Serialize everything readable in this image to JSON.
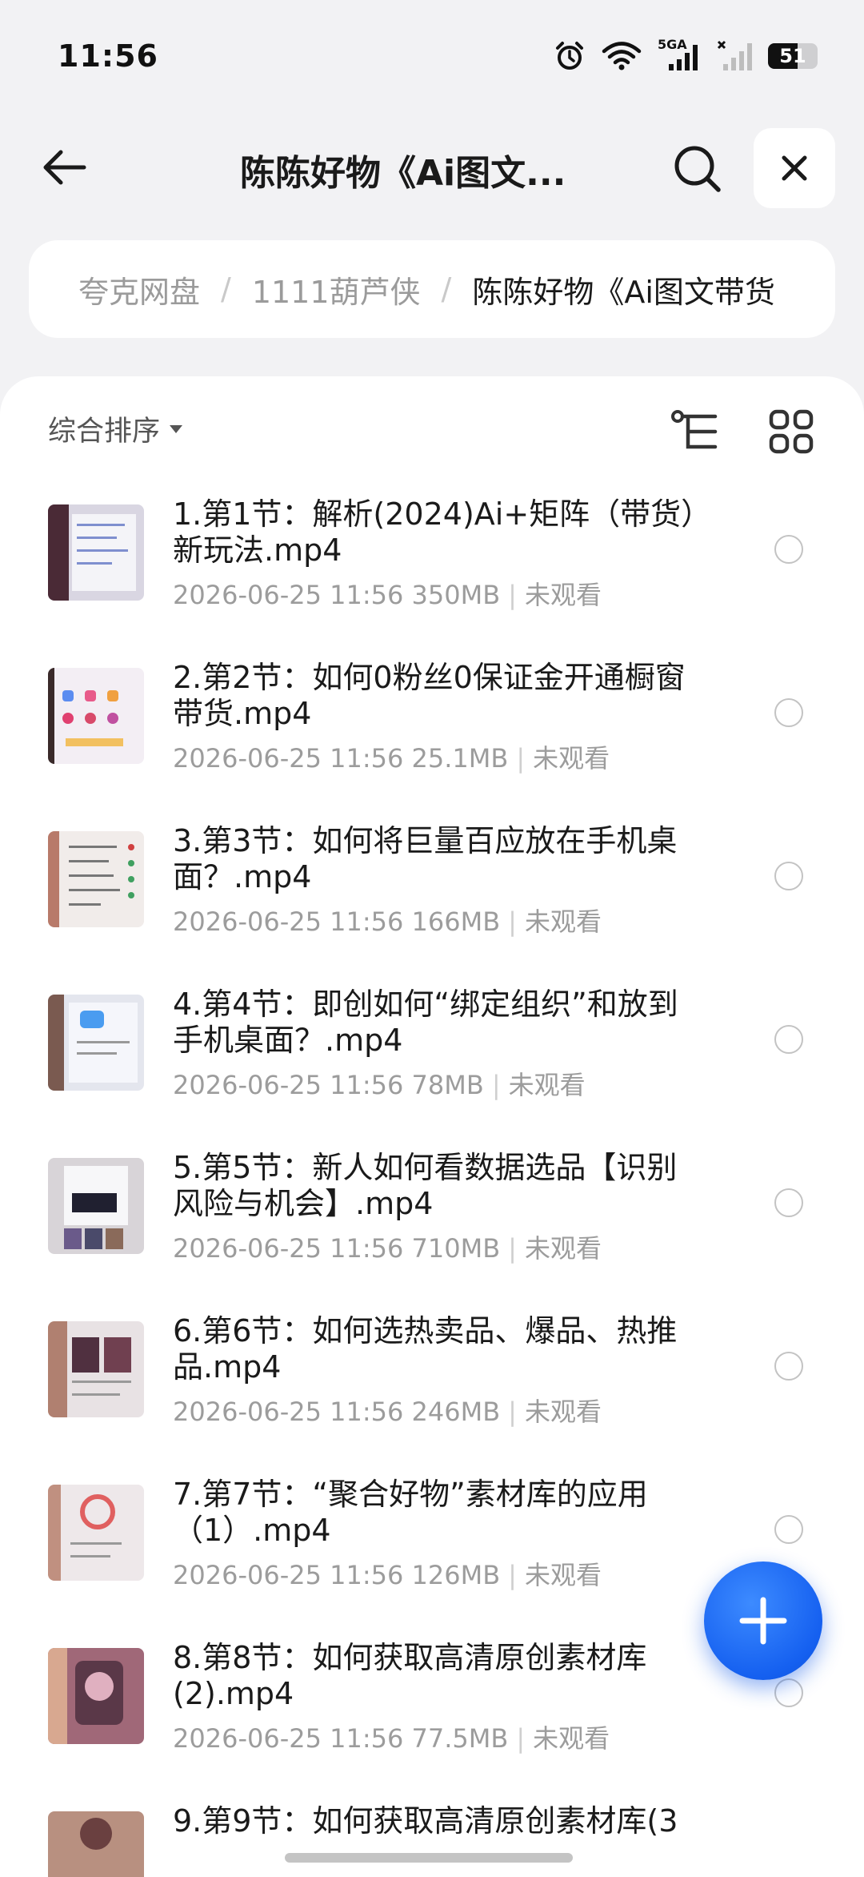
{
  "status_bar": {
    "time": "11:56",
    "network_label": "5GA",
    "battery": "51",
    "icons": [
      "alarm-icon",
      "wifi-icon",
      "signal-5ga-icon",
      "signal-no-service-icon",
      "battery-icon"
    ]
  },
  "header": {
    "title": "陈陈好物《Ai图文...",
    "icons": [
      "back-arrow-icon",
      "search-icon",
      "close-icon"
    ]
  },
  "breadcrumb": {
    "items": [
      "夸克网盘",
      "1111葫芦侠",
      "陈陈好物《Ai图文带货"
    ],
    "separator": "/"
  },
  "toolbar": {
    "sort_label": "综合排序",
    "icons": [
      "caret-down-icon",
      "tree-view-icon",
      "grid-view-icon"
    ]
  },
  "files": [
    {
      "name": "1.第1节：解析(2024)Ai+矩阵（带货）新玩法.mp4",
      "date": "2026-06-25 11:56",
      "size": "350MB",
      "status": "未观看"
    },
    {
      "name": "2.第2节：如何0粉丝0保证金开通橱窗带货.mp4",
      "date": "2026-06-25 11:56",
      "size": "25.1MB",
      "status": "未观看"
    },
    {
      "name": "3.第3节：如何将巨量百应放在手机桌面？.mp4",
      "date": "2026-06-25 11:56",
      "size": "166MB",
      "status": "未观看"
    },
    {
      "name": "4.第4节：即创如何“绑定组织”和放到手机桌面？.mp4",
      "date": "2026-06-25 11:56",
      "size": "78MB",
      "status": "未观看"
    },
    {
      "name": "5.第5节：新人如何看数据选品【识别风险与机会】.mp4",
      "date": "2026-06-25 11:56",
      "size": "710MB",
      "status": "未观看"
    },
    {
      "name": "6.第6节：如何选热卖品、爆品、热推品.mp4",
      "date": "2026-06-25 11:56",
      "size": "246MB",
      "status": "未观看"
    },
    {
      "name": "7.第7节：“聚合好物”素材库的应用（1）.mp4",
      "date": "2026-06-25 11:56",
      "size": "126MB",
      "status": "未观看"
    },
    {
      "name": "8.第8节：如何获取高清原创素材库(2).mp4",
      "date": "2026-06-25 11:56",
      "size": "77.5MB",
      "status": "未观看"
    },
    {
      "name": "9.第9节：如何获取高清原创素材库(3",
      "date": "",
      "size": "",
      "status": ""
    }
  ],
  "fab": {
    "icon": "plus-icon"
  },
  "colors": {
    "accent": "#1560f0",
    "meta_text": "#9c9c9c",
    "background": "#f2f2f4"
  }
}
